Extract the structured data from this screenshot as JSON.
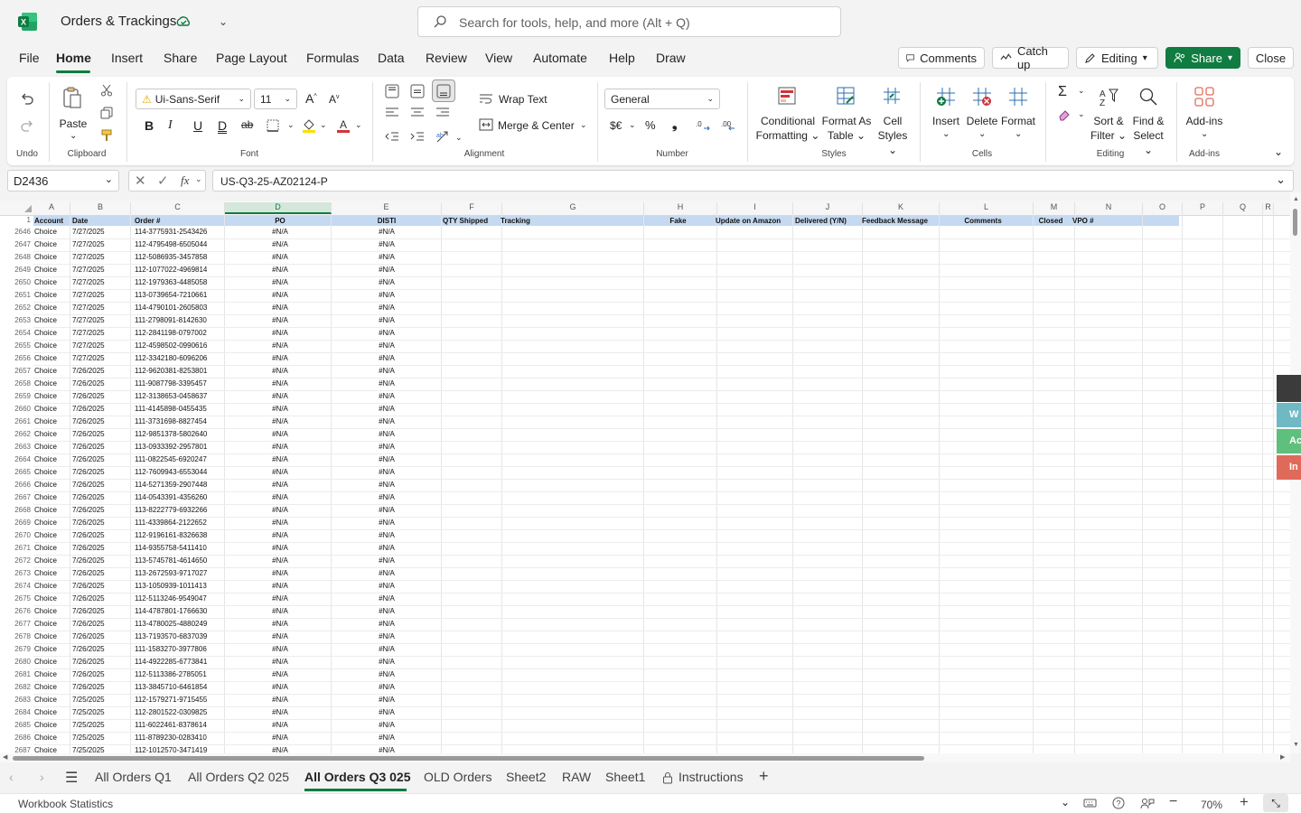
{
  "app": {
    "title": "Orders & Trackings",
    "search_placeholder": "Search for tools, help, and more (Alt + Q)"
  },
  "menu": [
    "File",
    "Home",
    "Insert",
    "Share",
    "Page Layout",
    "Formulas",
    "Data",
    "Review",
    "View",
    "Automate",
    "Help",
    "Draw"
  ],
  "header_buttons": {
    "comments": "Comments",
    "catchup": "Catch up",
    "editing": "Editing",
    "share": "Share",
    "close": "Close"
  },
  "ribbon": {
    "undo_group": "Undo",
    "clipboard_group": "Clipboard",
    "paste": "Paste",
    "font_name": "Ui-Sans-Serif",
    "font_size": "11",
    "font_group": "Font",
    "wrap_text": "Wrap Text",
    "merge_center": "Merge & Center",
    "alignment_group": "Alignment",
    "number_format": "General",
    "number_group": "Number",
    "currency": "$€",
    "conditional": [
      "Conditional",
      "Formatting"
    ],
    "format_table": [
      "Format As",
      "Table"
    ],
    "cell_styles": [
      "Cell",
      "Styles"
    ],
    "styles_group": "Styles",
    "insert": "Insert",
    "delete": "Delete",
    "format": "Format",
    "cells_group": "Cells",
    "sort_filter": [
      "Sort &",
      "Filter"
    ],
    "find_select": [
      "Find &",
      "Select"
    ],
    "editing_group": "Editing",
    "addins": "Add-ins",
    "addins_group": "Add-ins"
  },
  "formula": {
    "name_box": "D2436",
    "value": "US-Q3-25-AZ02124-P"
  },
  "columns": [
    "A",
    "B",
    "C",
    "D",
    "E",
    "F",
    "G",
    "H",
    "I",
    "J",
    "K",
    "L",
    "M",
    "N",
    "O",
    "P",
    "Q",
    "R"
  ],
  "header_row": {
    "num": "1",
    "cells": [
      "Account",
      "Date",
      "Order #",
      "PO",
      "DISTI",
      "QTY Shipped",
      "Tracking",
      "Fake",
      "Update on Amazon",
      "Delivered (Y/N)",
      "Feedback Message",
      "Comments",
      "Closed",
      "VPO #"
    ]
  },
  "rows": [
    [
      "2646",
      "Choice",
      "7/27/2025",
      "114-3775931-2543426",
      "#N/A",
      "#N/A"
    ],
    [
      "2647",
      "Choice",
      "7/27/2025",
      "112-4795498-6505044",
      "#N/A",
      "#N/A"
    ],
    [
      "2648",
      "Choice",
      "7/27/2025",
      "112-5086935-3457858",
      "#N/A",
      "#N/A"
    ],
    [
      "2649",
      "Choice",
      "7/27/2025",
      "112-1077022-4969814",
      "#N/A",
      "#N/A"
    ],
    [
      "2650",
      "Choice",
      "7/27/2025",
      "112-1979363-4485058",
      "#N/A",
      "#N/A"
    ],
    [
      "2651",
      "Choice",
      "7/27/2025",
      "113-0739654-7210661",
      "#N/A",
      "#N/A"
    ],
    [
      "2652",
      "Choice",
      "7/27/2025",
      "114-4790101-2605803",
      "#N/A",
      "#N/A"
    ],
    [
      "2653",
      "Choice",
      "7/27/2025",
      "111-2798091-8142630",
      "#N/A",
      "#N/A"
    ],
    [
      "2654",
      "Choice",
      "7/27/2025",
      "112-2841198-0797002",
      "#N/A",
      "#N/A"
    ],
    [
      "2655",
      "Choice",
      "7/27/2025",
      "112-4598502-0990616",
      "#N/A",
      "#N/A"
    ],
    [
      "2656",
      "Choice",
      "7/27/2025",
      "112-3342180-6096206",
      "#N/A",
      "#N/A"
    ],
    [
      "2657",
      "Choice",
      "7/26/2025",
      "112-9620381-8253801",
      "#N/A",
      "#N/A"
    ],
    [
      "2658",
      "Choice",
      "7/26/2025",
      "111-9087798-3395457",
      "#N/A",
      "#N/A"
    ],
    [
      "2659",
      "Choice",
      "7/26/2025",
      "112-3138653-0458637",
      "#N/A",
      "#N/A"
    ],
    [
      "2660",
      "Choice",
      "7/26/2025",
      "111-4145898-0455435",
      "#N/A",
      "#N/A"
    ],
    [
      "2661",
      "Choice",
      "7/26/2025",
      "111-3731698-8827454",
      "#N/A",
      "#N/A"
    ],
    [
      "2662",
      "Choice",
      "7/26/2025",
      "112-9851378-5802640",
      "#N/A",
      "#N/A"
    ],
    [
      "2663",
      "Choice",
      "7/26/2025",
      "113-0933392-2957801",
      "#N/A",
      "#N/A"
    ],
    [
      "2664",
      "Choice",
      "7/26/2025",
      "111-0822545-6920247",
      "#N/A",
      "#N/A"
    ],
    [
      "2665",
      "Choice",
      "7/26/2025",
      "112-7609943-6553044",
      "#N/A",
      "#N/A"
    ],
    [
      "2666",
      "Choice",
      "7/26/2025",
      "114-5271359-2907448",
      "#N/A",
      "#N/A"
    ],
    [
      "2667",
      "Choice",
      "7/26/2025",
      "114-0543391-4356260",
      "#N/A",
      "#N/A"
    ],
    [
      "2668",
      "Choice",
      "7/26/2025",
      "113-8222779-6932266",
      "#N/A",
      "#N/A"
    ],
    [
      "2669",
      "Choice",
      "7/26/2025",
      "111-4339864-2122652",
      "#N/A",
      "#N/A"
    ],
    [
      "2670",
      "Choice",
      "7/26/2025",
      "112-9196161-8326638",
      "#N/A",
      "#N/A"
    ],
    [
      "2671",
      "Choice",
      "7/26/2025",
      "114-9355758-5411410",
      "#N/A",
      "#N/A"
    ],
    [
      "2672",
      "Choice",
      "7/26/2025",
      "113-5745781-4614650",
      "#N/A",
      "#N/A"
    ],
    [
      "2673",
      "Choice",
      "7/26/2025",
      "113-2672593-9717027",
      "#N/A",
      "#N/A"
    ],
    [
      "2674",
      "Choice",
      "7/26/2025",
      "113-1050939-1011413",
      "#N/A",
      "#N/A"
    ],
    [
      "2675",
      "Choice",
      "7/26/2025",
      "112-5113246-9549047",
      "#N/A",
      "#N/A"
    ],
    [
      "2676",
      "Choice",
      "7/26/2025",
      "114-4787801-1766630",
      "#N/A",
      "#N/A"
    ],
    [
      "2677",
      "Choice",
      "7/26/2025",
      "113-4780025-4880249",
      "#N/A",
      "#N/A"
    ],
    [
      "2678",
      "Choice",
      "7/26/2025",
      "113-7193570-6837039",
      "#N/A",
      "#N/A"
    ],
    [
      "2679",
      "Choice",
      "7/26/2025",
      "111-1583270-3977806",
      "#N/A",
      "#N/A"
    ],
    [
      "2680",
      "Choice",
      "7/26/2025",
      "114-4922285-6773841",
      "#N/A",
      "#N/A"
    ],
    [
      "2681",
      "Choice",
      "7/26/2025",
      "112-5113386-2785051",
      "#N/A",
      "#N/A"
    ],
    [
      "2682",
      "Choice",
      "7/26/2025",
      "113-3845710-6461854",
      "#N/A",
      "#N/A"
    ],
    [
      "2683",
      "Choice",
      "7/25/2025",
      "112-1579271-9715455",
      "#N/A",
      "#N/A"
    ],
    [
      "2684",
      "Choice",
      "7/25/2025",
      "112-2801522-0309825",
      "#N/A",
      "#N/A"
    ],
    [
      "2685",
      "Choice",
      "7/25/2025",
      "111-6022461-8378614",
      "#N/A",
      "#N/A"
    ],
    [
      "2686",
      "Choice",
      "7/25/2025",
      "111-8789230-0283410",
      "#N/A",
      "#N/A"
    ],
    [
      "2687",
      "Choice",
      "7/25/2025",
      "112-1012570-3471419",
      "#N/A",
      "#N/A"
    ]
  ],
  "sheets": [
    "All Orders Q1",
    "All Orders Q2 025",
    "All Orders Q3 025",
    "OLD Orders",
    "Sheet2",
    "RAW",
    "Sheet1",
    "Instructions"
  ],
  "status": {
    "left": "Workbook Statistics",
    "zoom": "70%"
  },
  "side_panel": [
    "W",
    "Ac",
    "In"
  ],
  "colors": {
    "accent": "#107c41",
    "header_fill": "#c5d9f1"
  }
}
